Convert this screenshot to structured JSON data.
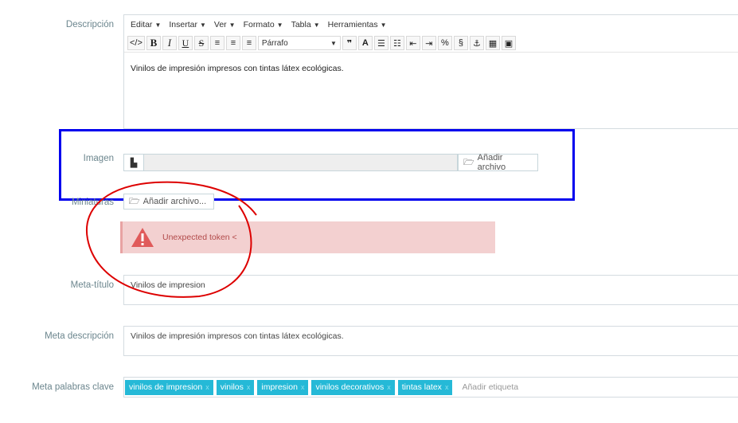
{
  "labels": {
    "descripcion": "Descripción",
    "imagen": "Imagen",
    "miniaturas": "Miniaturas",
    "meta_titulo": "Meta-título",
    "meta_descripcion": "Meta descripción",
    "meta_palabras": "Meta palabras clave"
  },
  "editor": {
    "menus": [
      "Editar",
      "Insertar",
      "Ver",
      "Formato",
      "Tabla",
      "Herramientas"
    ],
    "format_value": "Párrafo",
    "content": "Vinilos de impresión impresos con tintas látex ecológicas."
  },
  "imagen": {
    "button_label": "Añadir archivo"
  },
  "miniaturas": {
    "button_label": "Añadir archivo..."
  },
  "alert": {
    "text": "Unexpected token <"
  },
  "meta_titulo": {
    "value": "Vinilos de impresion"
  },
  "meta_descripcion": {
    "value": "Vinilos de impresión impresos con tintas látex ecológicas."
  },
  "tags": {
    "items": [
      "vinilos de impresion",
      "vinilos",
      "impresion",
      "vinilos decorativos",
      "tintas latex"
    ],
    "placeholder": "Añadir etiqueta"
  },
  "colors": {
    "label": "#6c868e",
    "tag": "#25b9d7",
    "highlight_box": "#0000ee",
    "annotation": "#dd0000",
    "alert_bg": "#f3d0d0"
  }
}
